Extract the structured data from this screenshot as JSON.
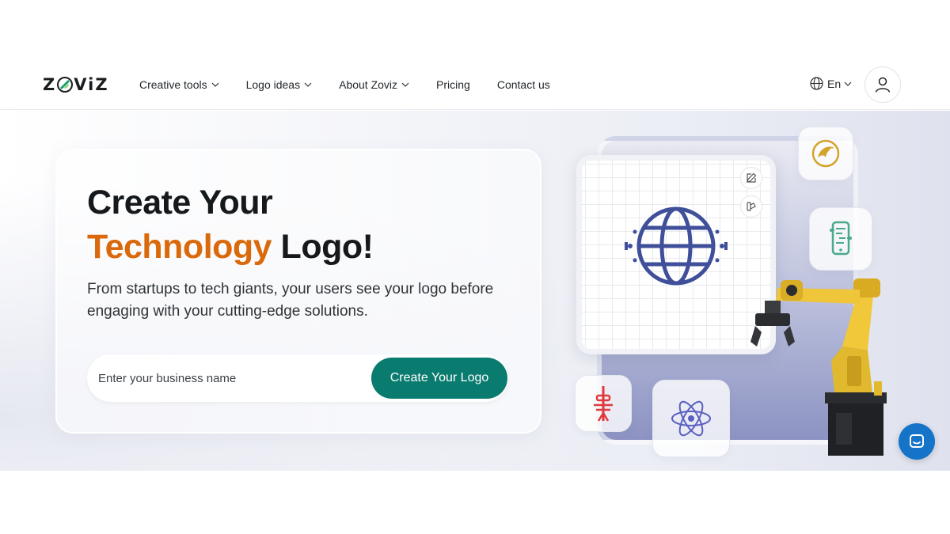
{
  "brand": {
    "logo_text_left": "Z",
    "logo_text_right": "ViZ",
    "accent": "#0a7b6f"
  },
  "nav": {
    "items": [
      {
        "label": "Creative tools",
        "has_dropdown": true
      },
      {
        "label": "Logo ideas",
        "has_dropdown": true
      },
      {
        "label": "About Zoviz",
        "has_dropdown": true
      },
      {
        "label": "Pricing",
        "has_dropdown": false
      },
      {
        "label": "Contact us",
        "has_dropdown": false
      }
    ],
    "language": "En"
  },
  "hero": {
    "title_line1": "Create Your",
    "title_accent": "Technology",
    "title_rest": " Logo!",
    "title_accent_color": "#d9690b",
    "description": "From startups to tech giants, your users see your logo before engaging with your cutting-edge solutions.",
    "search": {
      "placeholder": "Enter your business name",
      "value": ""
    },
    "cta_label": "Create Your Logo"
  },
  "illustration": {
    "main_icon": "globe-icon",
    "tool_icons": [
      "edit-icon",
      "palette-icon"
    ],
    "tiles": [
      "bird-logo-icon",
      "phone-chip-icon",
      "tower-logo-icon",
      "atom-icon"
    ],
    "robot": "robotic-arm"
  },
  "widgets": {
    "chat_icon": "chat-icon",
    "chat_color": "#1573c8"
  }
}
